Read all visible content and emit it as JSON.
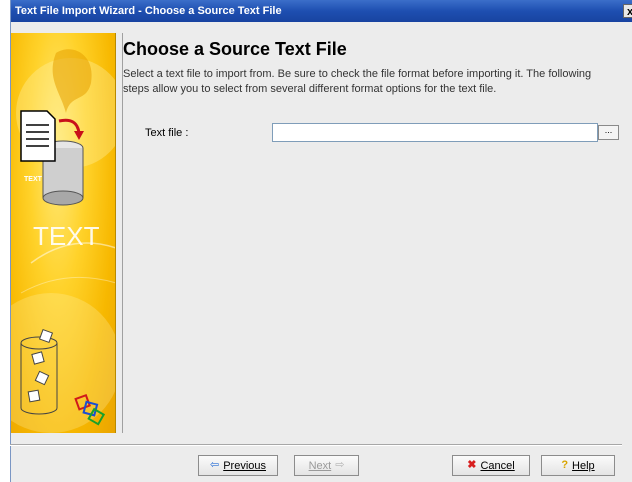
{
  "window": {
    "title": "Text File Import Wizard - Choose a Source Text File",
    "close_glyph": "x"
  },
  "sidebar": {
    "banner_word": "TEXT",
    "small_label": "TEXT"
  },
  "page": {
    "heading": "Choose a Source Text File",
    "description": "Select a text file to import from. Be sure to check the file format before importing it. The following steps allow you to select from several different format options for the text file."
  },
  "form": {
    "text_file_label": "Text file :",
    "text_file_value": "",
    "browse_label": "..."
  },
  "buttons": {
    "previous": "Previous",
    "next": "Next",
    "cancel": "Cancel",
    "help": "Help"
  },
  "icons": {
    "previous": "left-arrow-icon",
    "next": "right-arrow-icon",
    "cancel": "red-x-icon",
    "help": "question-mark-icon"
  }
}
